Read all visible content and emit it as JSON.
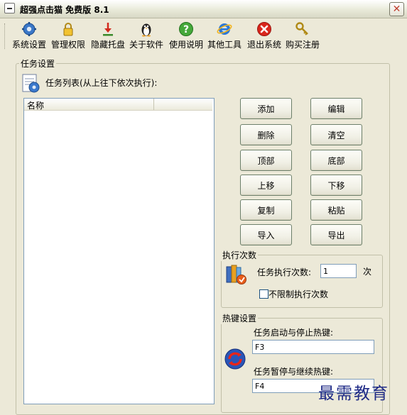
{
  "window": {
    "title": "超强点击猫 免费版 8.1"
  },
  "toolbar": {
    "items": [
      {
        "label": "系统设置",
        "icon": "gear-icon"
      },
      {
        "label": "管理权限",
        "icon": "lock-icon"
      },
      {
        "label": "隐藏托盘",
        "icon": "download-arrow-icon"
      },
      {
        "label": "关于软件",
        "icon": "penguin-icon"
      },
      {
        "label": "使用说明",
        "icon": "help-icon"
      },
      {
        "label": "其他工具",
        "icon": "ie-icon"
      },
      {
        "label": "退出系统",
        "icon": "exit-x-icon"
      },
      {
        "label": "购买注册",
        "icon": "key-icon"
      }
    ]
  },
  "task_settings": {
    "group_label": "任务设置",
    "list_label": "任务列表(从上往下依次执行):",
    "column_name": "名称"
  },
  "buttons": {
    "add": "添加",
    "edit": "编辑",
    "delete": "删除",
    "clear": "清空",
    "top": "顶部",
    "bottom": "底部",
    "move_up": "上移",
    "move_down": "下移",
    "copy": "复制",
    "paste": "粘贴",
    "import": "导入",
    "export": "导出"
  },
  "exec_count": {
    "group_label": "执行次数",
    "count_label": "任务执行次数:",
    "count_value": "1",
    "unit": "次",
    "unlimited_label": "不限制执行次数",
    "unlimited_checked": false
  },
  "hotkeys": {
    "group_label": "热键设置",
    "start_stop_label": "任务启动与停止热键:",
    "start_stop_value": "F3",
    "pause_resume_label": "任务暂停与继续热键:",
    "pause_resume_value": "F4"
  },
  "watermark": "最需教育"
}
